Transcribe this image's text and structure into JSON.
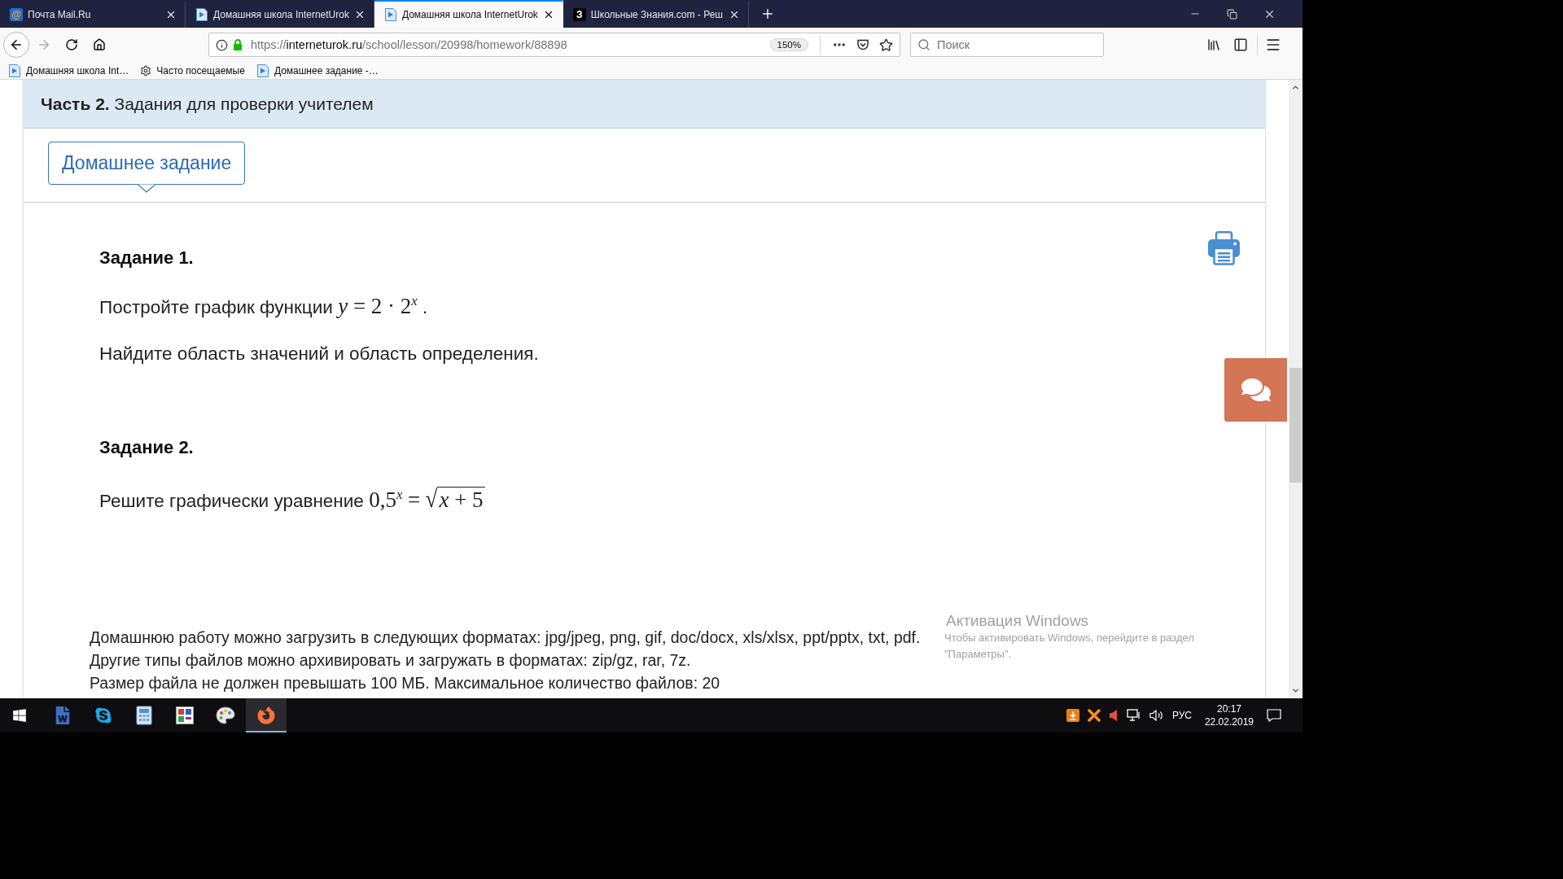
{
  "browser": {
    "tabs": [
      {
        "title": "Почта Mail.Ru",
        "kind": "mail",
        "glyph": "@",
        "selected": false
      },
      {
        "title": "Домашняя школа InternetUrok",
        "kind": "lesson",
        "selected": false
      },
      {
        "title": "Домашняя школа InternetUrok",
        "kind": "lesson",
        "selected": true
      },
      {
        "title": "Школьные Знания.com - Реш",
        "kind": "znania",
        "glyph": "З",
        "selected": false
      }
    ],
    "navigation": {
      "back": {
        "disabled": false
      },
      "forward": {
        "disabled": true
      }
    },
    "address": {
      "scheme": "https://",
      "host": "interneturok.ru",
      "path": "/school/lesson/20998/homework/88898",
      "zoom": "150%"
    },
    "search": {
      "placeholder": "Поиск"
    },
    "bookmarks": [
      {
        "label": "Домашняя школа Int…",
        "kind": "page"
      },
      {
        "label": "Часто посещаемые",
        "kind": "smart"
      },
      {
        "label": "Домашнее задание -…",
        "kind": "page"
      }
    ]
  },
  "page": {
    "section_title": "**Часть 2.** Задания для проверки учителем",
    "tabs": [
      {
        "label": "Домашнее задание",
        "selected": true
      }
    ],
    "tasks": [
      {
        "title": "Задание 1.",
        "lines": [
          {
            "text": "Постройте график функции",
            "formula": "*y* = 2 · 2$^{x}$",
            "tail": "."
          },
          {
            "text": "Найдите область значений и область определения."
          }
        ]
      },
      {
        "title": "Задание 2.",
        "lines": [
          {
            "text": "Решите графически уравнение",
            "formula": "0,5$^{x}$ =",
            "radical": {
              "sign": "√",
              "radicand": "*x* + 5"
            }
          }
        ]
      }
    ],
    "upload_info": [
      "Домашнюю работу можно загрузить в следующих форматах: jpg/jpeg, png, gif, doc/docx, xls/xlsx, ppt/pptx, txt, pdf.",
      "Другие типы файлов можно архивировать и загружать в форматах: zip/gz, rar, 7z.",
      "Размер файла не должен превышать 100 МБ. Максимальное количество файлов: 20"
    ]
  },
  "activation_notice": {
    "title": "Активация Windows",
    "lines": [
      "Чтобы активировать Windows, перейдите в раздел",
      "\"Параметры\"."
    ]
  },
  "taskbar": {
    "apps": [
      {
        "kind": "word",
        "active": false
      },
      {
        "kind": "skype",
        "active": false
      },
      {
        "kind": "calculator",
        "active": false
      },
      {
        "kind": "abc",
        "active": false
      },
      {
        "kind": "paint",
        "active": false
      },
      {
        "kind": "firefox",
        "active": true
      }
    ],
    "language": "РУС",
    "time": "20:17",
    "date": "22.02.2019"
  }
}
